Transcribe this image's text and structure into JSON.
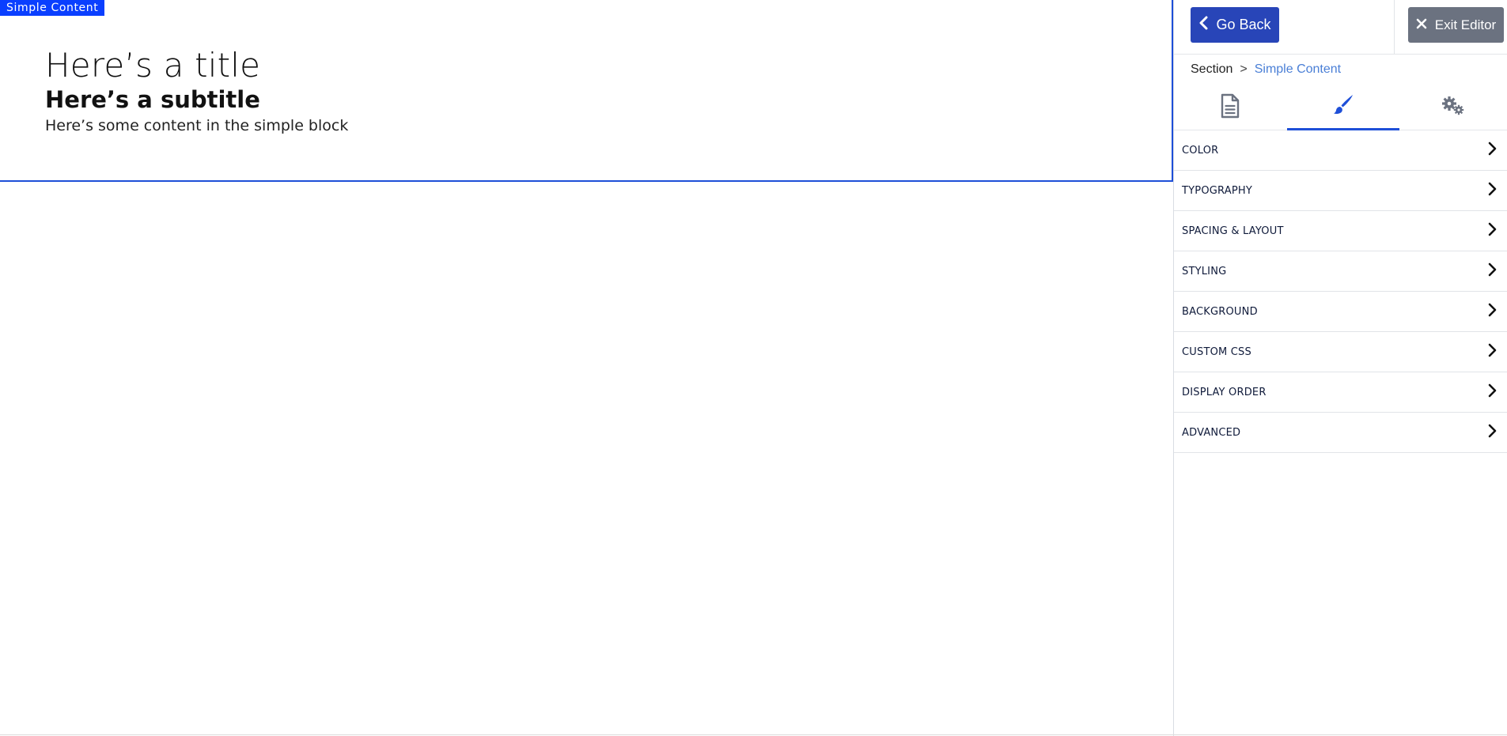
{
  "canvas": {
    "block_tag": "Simple Content",
    "title": "Here’s a title",
    "subtitle": "Here’s a subtitle",
    "body": "Here’s some content in the simple block"
  },
  "panel": {
    "go_back_label": "Go Back",
    "exit_label": "Exit Editor",
    "breadcrumb": {
      "root": "Section",
      "separator": ">",
      "current": "Simple Content"
    },
    "tabs": [
      {
        "icon": "document-icon",
        "active": false
      },
      {
        "icon": "brush-icon",
        "active": true
      },
      {
        "icon": "gears-icon",
        "active": false
      }
    ],
    "accordion": [
      {
        "label": "COLOR"
      },
      {
        "label": "TYPOGRAPHY"
      },
      {
        "label": "SPACING & LAYOUT"
      },
      {
        "label": "STYLING"
      },
      {
        "label": "BACKGROUND"
      },
      {
        "label": "CUSTOM CSS"
      },
      {
        "label": "DISPLAY ORDER"
      },
      {
        "label": "ADVANCED"
      }
    ]
  },
  "colors": {
    "accent_blue": "#1e4fd8",
    "tag_blue": "#0a3fff",
    "back_button": "#2845b8",
    "exit_button": "#6b7280",
    "breadcrumb_link": "#4a7fd6"
  }
}
